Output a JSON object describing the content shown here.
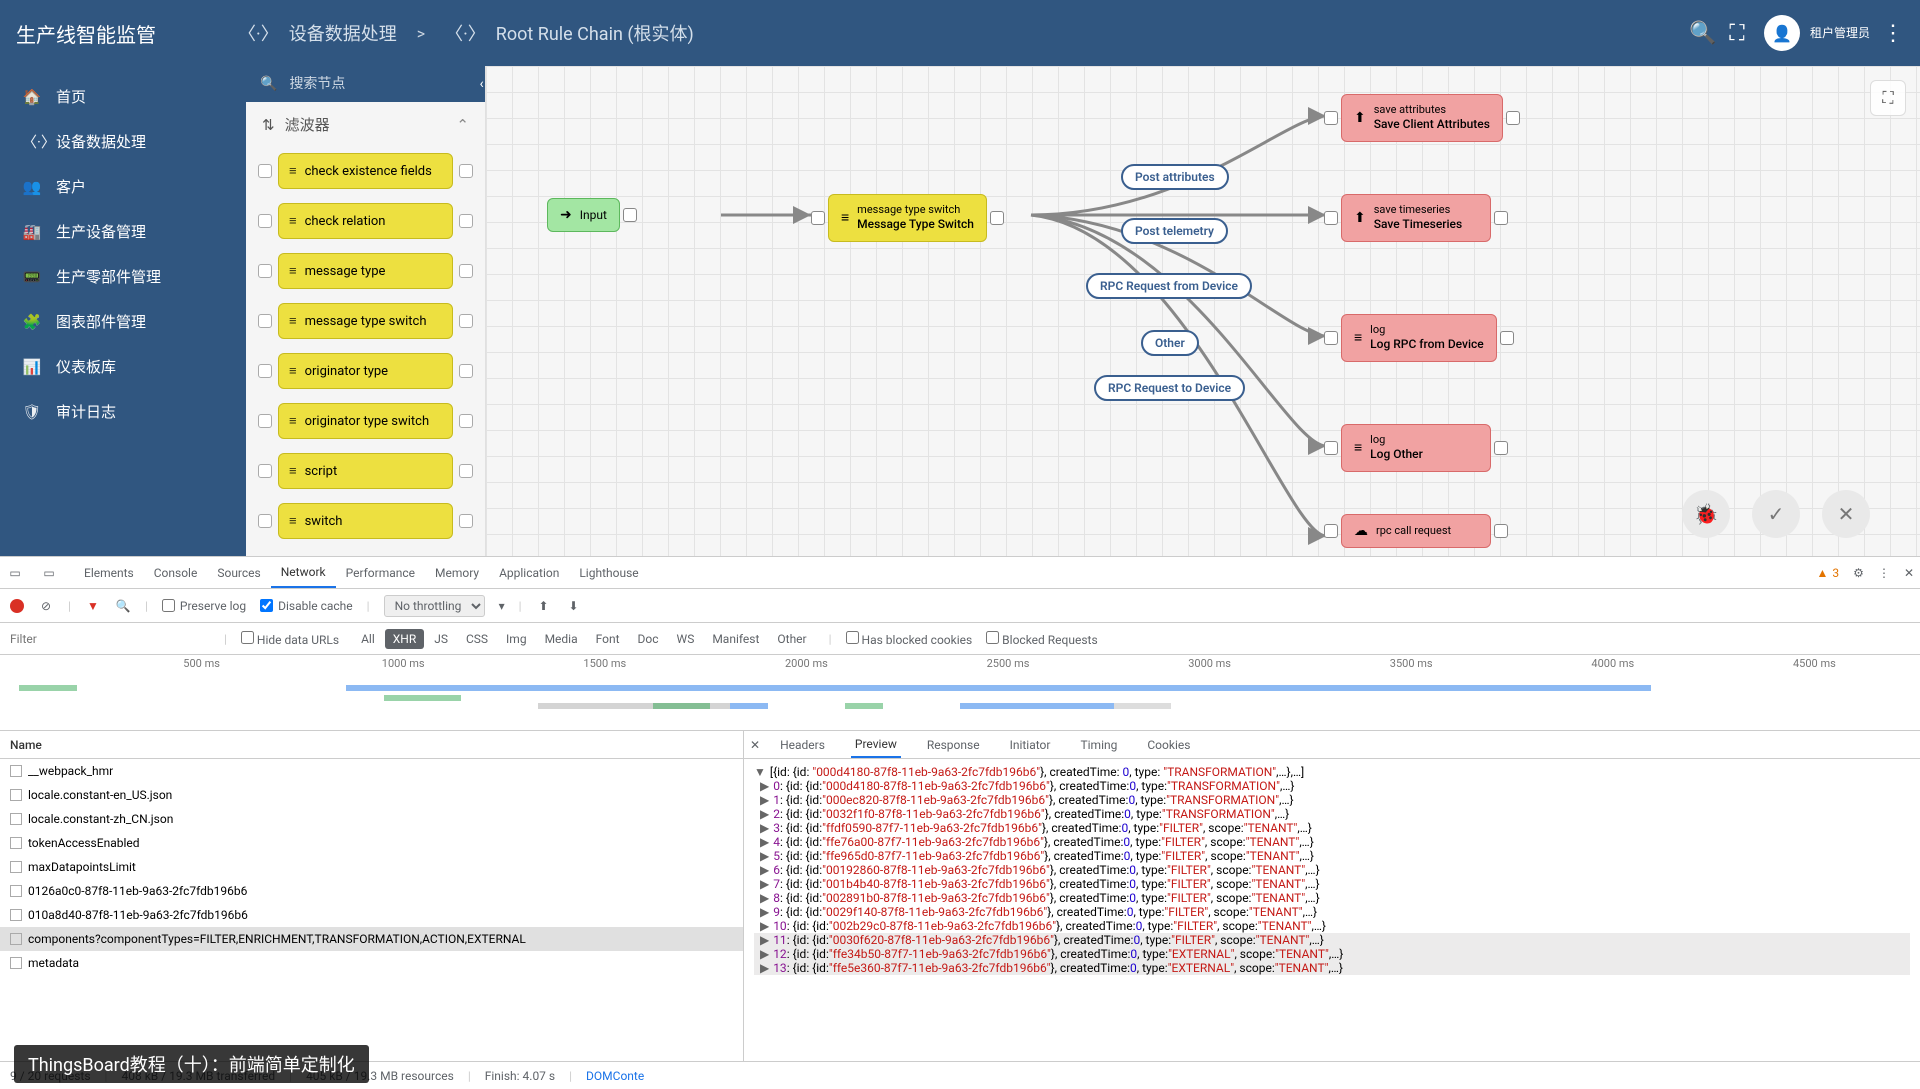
{
  "brand": "生产线智能监管",
  "breadcrumb": {
    "seg1": "设备数据处理",
    "sep": ">",
    "seg2": "Root Rule Chain (根实体)"
  },
  "user": {
    "line1": "租户管理员",
    "line2": "· · ·"
  },
  "sidenav": [
    {
      "icon": "🏠",
      "label": "首页"
    },
    {
      "icon": "〈·〉",
      "label": "设备数据处理"
    },
    {
      "icon": "👥",
      "label": "客户"
    },
    {
      "icon": "🏭",
      "label": "生产设备管理"
    },
    {
      "icon": "📟",
      "label": "生产零部件管理"
    },
    {
      "icon": "🧩",
      "label": "图表部件管理"
    },
    {
      "icon": "📊",
      "label": "仪表板库"
    },
    {
      "icon": "🛡",
      "label": "审计日志"
    }
  ],
  "palette": {
    "search_placeholder": "搜索节点",
    "filter_label": "滤波器",
    "items": [
      "check existence fields",
      "check relation",
      "message type",
      "message type switch",
      "originator type",
      "originator type switch",
      "script",
      "switch"
    ]
  },
  "canvas": {
    "input": "Input",
    "switch": {
      "l1": "message type switch",
      "l2": "Message Type Switch"
    },
    "labels": [
      "Post attributes",
      "Post telemetry",
      "RPC Request from Device",
      "Other",
      "RPC Request to Device"
    ],
    "nodes": [
      {
        "l1": "save attributes",
        "l2": "Save Client Attributes"
      },
      {
        "l1": "save timeseries",
        "l2": "Save Timeseries"
      },
      {
        "l1": "log",
        "l2": "Log RPC from Device"
      },
      {
        "l1": "log",
        "l2": "Log Other"
      },
      {
        "l1": "rpc call request",
        "l2": ""
      }
    ]
  },
  "devtools": {
    "tabs": [
      "Elements",
      "Console",
      "Sources",
      "Network",
      "Performance",
      "Memory",
      "Application",
      "Lighthouse"
    ],
    "active_tab": "Network",
    "warn_count": "3",
    "preserve_log": "Preserve log",
    "disable_cache": "Disable cache",
    "throttling": "No throttling",
    "filter_placeholder": "Filter",
    "hide_data_urls": "Hide data URLs",
    "types": [
      "All",
      "XHR",
      "JS",
      "CSS",
      "Img",
      "Media",
      "Font",
      "Doc",
      "WS",
      "Manifest",
      "Other"
    ],
    "active_type": "XHR",
    "blocked_cookies": "Has blocked cookies",
    "blocked_requests": "Blocked Requests",
    "timeline_ticks": [
      "500 ms",
      "1000 ms",
      "1500 ms",
      "2000 ms",
      "2500 ms",
      "3000 ms",
      "3500 ms",
      "4000 ms",
      "4500 ms"
    ],
    "list_header": "Name",
    "requests": [
      "__webpack_hmr",
      "locale.constant-en_US.json",
      "locale.constant-zh_CN.json",
      "tokenAccessEnabled",
      "maxDatapointsLimit",
      "0126a0c0-87f8-11eb-9a63-2fc7fdb196b6",
      "010a8d40-87f8-11eb-9a63-2fc7fdb196b6",
      "components?componentTypes=FILTER,ENRICHMENT,TRANSFORMATION,ACTION,EXTERNAL",
      "metadata"
    ],
    "selected_request_idx": 7,
    "detail_tabs": [
      "Headers",
      "Preview",
      "Response",
      "Initiator",
      "Timing",
      "Cookies"
    ],
    "active_detail_tab": "Preview",
    "preview_root": "[{id: {id: \"000d4180-87f8-11eb-9a63-2fc7fdb196b6\"}, createdTime: 0, type: \"TRANSFORMATION\",…},…]",
    "preview_lines": [
      {
        "idx": "0",
        "id": "000d4180-87f8-11eb-9a63-2fc7fdb196b6",
        "type": "TRANSFORMATION",
        "scope": null
      },
      {
        "idx": "1",
        "id": "000ec820-87f8-11eb-9a63-2fc7fdb196b6",
        "type": "TRANSFORMATION",
        "scope": null
      },
      {
        "idx": "2",
        "id": "0032f1f0-87f8-11eb-9a63-2fc7fdb196b6",
        "type": "TRANSFORMATION",
        "scope": null
      },
      {
        "idx": "3",
        "id": "ffdf0590-87f7-11eb-9a63-2fc7fdb196b6",
        "type": "FILTER",
        "scope": "TENANT"
      },
      {
        "idx": "4",
        "id": "ffe76a00-87f7-11eb-9a63-2fc7fdb196b6",
        "type": "FILTER",
        "scope": "TENANT"
      },
      {
        "idx": "5",
        "id": "ffe965d0-87f7-11eb-9a63-2fc7fdb196b6",
        "type": "FILTER",
        "scope": "TENANT"
      },
      {
        "idx": "6",
        "id": "00192860-87f8-11eb-9a63-2fc7fdb196b6",
        "type": "FILTER",
        "scope": "TENANT"
      },
      {
        "idx": "7",
        "id": "001b4b40-87f8-11eb-9a63-2fc7fdb196b6",
        "type": "FILTER",
        "scope": "TENANT"
      },
      {
        "idx": "8",
        "id": "002891b0-87f8-11eb-9a63-2fc7fdb196b6",
        "type": "FILTER",
        "scope": "TENANT"
      },
      {
        "idx": "9",
        "id": "0029f140-87f8-11eb-9a63-2fc7fdb196b6",
        "type": "FILTER",
        "scope": "TENANT"
      },
      {
        "idx": "10",
        "id": "002b29c0-87f8-11eb-9a63-2fc7fdb196b6",
        "type": "FILTER",
        "scope": "TENANT"
      },
      {
        "idx": "11",
        "id": "0030f620-87f8-11eb-9a63-2fc7fdb196b6",
        "type": "FILTER",
        "scope": "TENANT",
        "grey": true
      },
      {
        "idx": "12",
        "id": "ffe34b50-87f7-11eb-9a63-2fc7fdb196b6",
        "type": "EXTERNAL",
        "scope": "TENANT",
        "grey": true
      },
      {
        "idx": "13",
        "id": "ffe5e360-87f7-11eb-9a63-2fc7fdb196b6",
        "type": "EXTERNAL",
        "scope": "TENANT",
        "grey": true
      }
    ],
    "status": {
      "requests": "9 / 20 requests",
      "transferred": "408 kB / 19.3 MB transferred",
      "resources": "405 kB / 19.3 MB resources",
      "finish": "Finish: 4.07 s",
      "domcontent": "DOMConte"
    },
    "overlay": "ThingsBoard教程（十）：前端简单定制化"
  }
}
